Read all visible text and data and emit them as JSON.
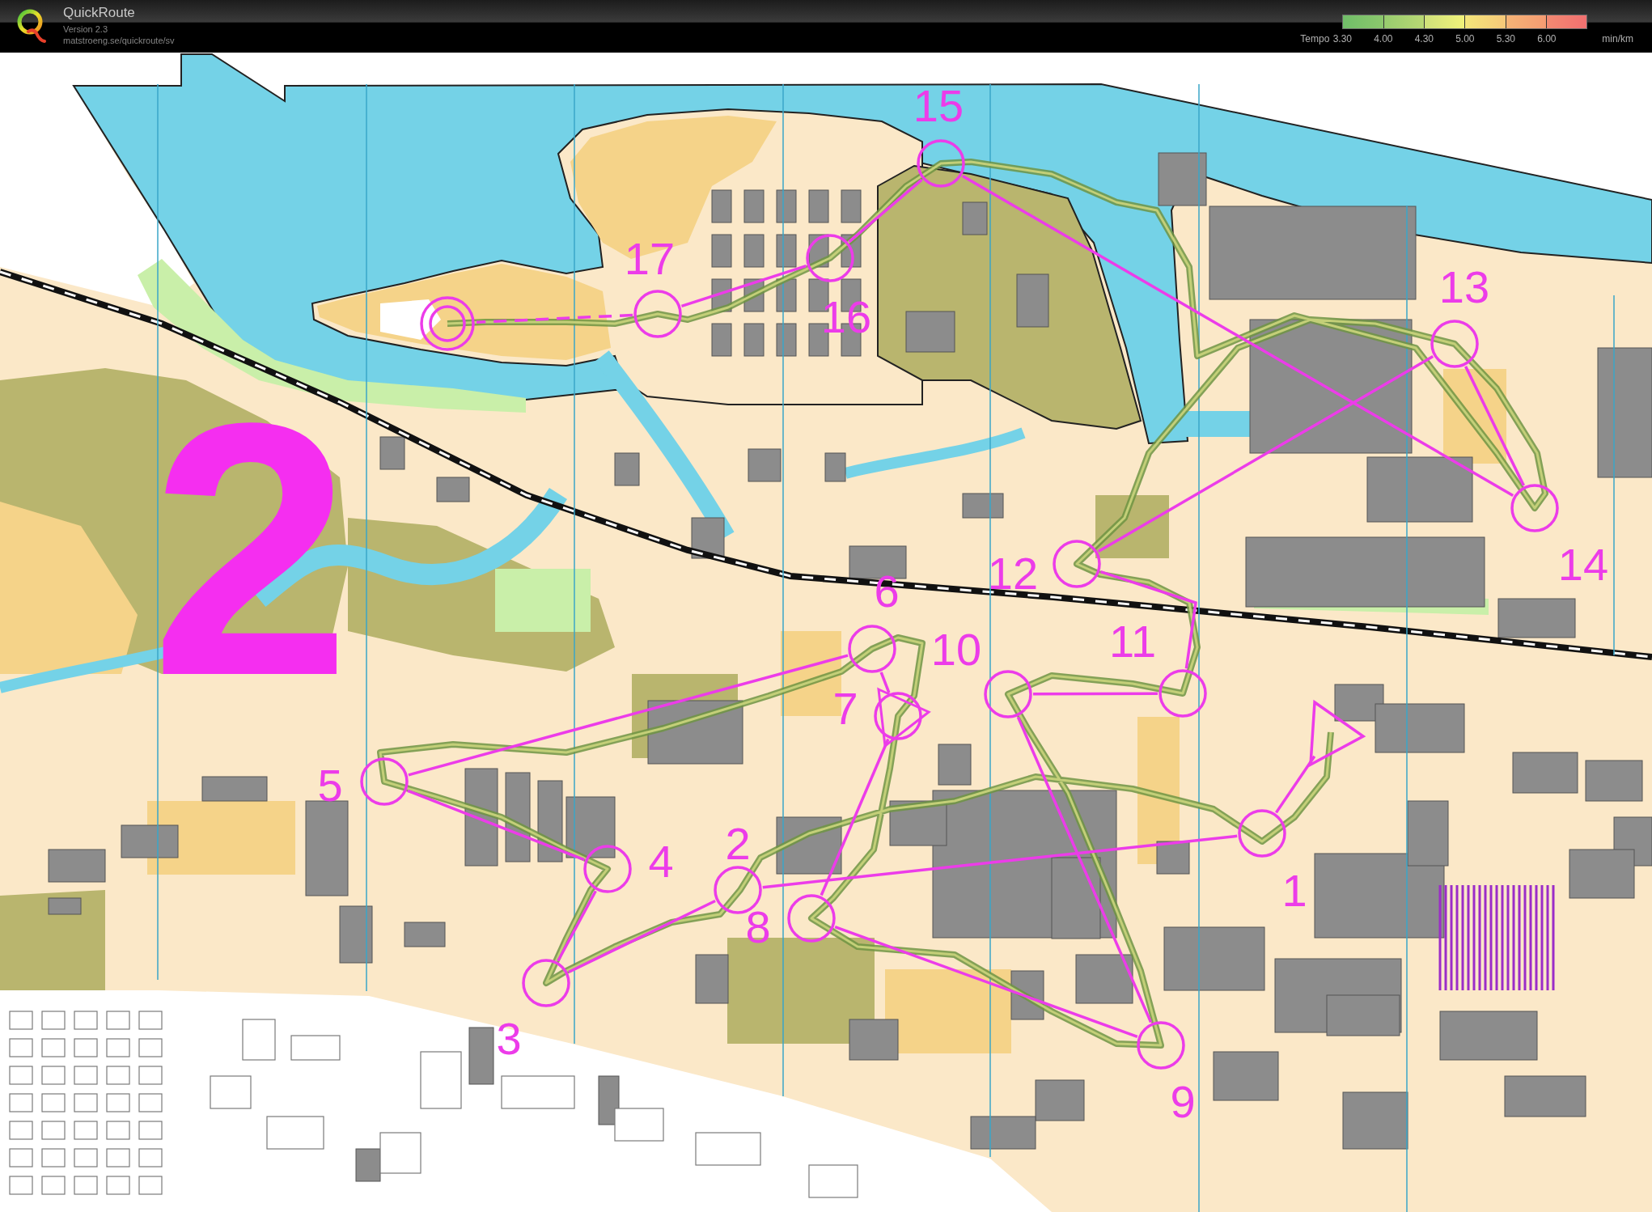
{
  "header": {
    "app_name": "QuickRoute",
    "version": "Version 2.3",
    "url": "matstroeng.se/quickroute/sv"
  },
  "tempo_legend": {
    "label": "Tempo",
    "ticks": [
      "3.30",
      "4.00",
      "4.30",
      "5.00",
      "5.30",
      "6.00"
    ],
    "unit": "min/km"
  },
  "map": {
    "course_part": "2",
    "controls": [
      {
        "kind": "start"
      },
      {
        "kind": "control",
        "number": "1"
      },
      {
        "kind": "control",
        "number": "2"
      },
      {
        "kind": "control",
        "number": "3"
      },
      {
        "kind": "control",
        "number": "4"
      },
      {
        "kind": "control",
        "number": "5"
      },
      {
        "kind": "control",
        "number": "6"
      },
      {
        "kind": "control",
        "number": "7"
      },
      {
        "kind": "control",
        "number": "8"
      },
      {
        "kind": "control",
        "number": "9"
      },
      {
        "kind": "control",
        "number": "10"
      },
      {
        "kind": "control",
        "number": "11"
      },
      {
        "kind": "control",
        "number": "12"
      },
      {
        "kind": "control",
        "number": "13"
      },
      {
        "kind": "control",
        "number": "14"
      },
      {
        "kind": "control",
        "number": "15"
      },
      {
        "kind": "control",
        "number": "16"
      },
      {
        "kind": "control",
        "number": "17"
      },
      {
        "kind": "finish"
      }
    ]
  }
}
